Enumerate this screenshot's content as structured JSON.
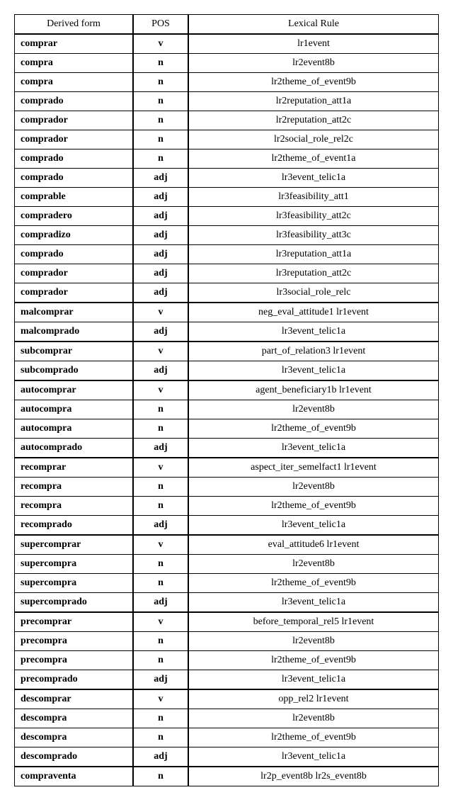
{
  "chart_data": {
    "type": "table",
    "headers": [
      "Derived form",
      "POS",
      "Lexical Rule"
    ],
    "rows": [
      {
        "form": "comprar",
        "pos": "v",
        "rule": "lr1event",
        "break": false
      },
      {
        "form": "compra",
        "pos": "n",
        "rule": "lr2event8b",
        "break": false
      },
      {
        "form": "compra",
        "pos": "n",
        "rule": "lr2theme_of_event9b",
        "break": false
      },
      {
        "form": "comprado",
        "pos": "n",
        "rule": "lr2reputation_att1a",
        "break": false
      },
      {
        "form": "comprador",
        "pos": "n",
        "rule": "lr2reputation_att2c",
        "break": false
      },
      {
        "form": "comprador",
        "pos": "n",
        "rule": "lr2social_role_rel2c",
        "break": false
      },
      {
        "form": "comprado",
        "pos": "n",
        "rule": "lr2theme_of_event1a",
        "break": false
      },
      {
        "form": "comprado",
        "pos": "adj",
        "rule": "lr3event_telic1a",
        "break": false
      },
      {
        "form": "comprable",
        "pos": "adj",
        "rule": "lr3feasibility_att1",
        "break": false
      },
      {
        "form": "compradero",
        "pos": "adj",
        "rule": "lr3feasibility_att2c",
        "break": false
      },
      {
        "form": "compradizo",
        "pos": "adj",
        "rule": "lr3feasibility_att3c",
        "break": false
      },
      {
        "form": "comprado",
        "pos": "adj",
        "rule": "lr3reputation_att1a",
        "break": false
      },
      {
        "form": "comprador",
        "pos": "adj",
        "rule": "lr3reputation_att2c",
        "break": false
      },
      {
        "form": "comprador",
        "pos": "adj",
        "rule": "lr3social_role_relc",
        "break": false
      },
      {
        "form": "malcomprar",
        "pos": "v",
        "rule": "neg_eval_attitude1 lr1event",
        "break": true
      },
      {
        "form": "malcomprado",
        "pos": "adj",
        "rule": "lr3event_telic1a",
        "break": false
      },
      {
        "form": "subcomprar",
        "pos": "v",
        "rule": "part_of_relation3 lr1event",
        "break": true
      },
      {
        "form": "subcomprado",
        "pos": "adj",
        "rule": "lr3event_telic1a",
        "break": false
      },
      {
        "form": "autocomprar",
        "pos": "v",
        "rule": "agent_beneficiary1b lr1event",
        "break": true
      },
      {
        "form": "autocompra",
        "pos": "n",
        "rule": "lr2event8b",
        "break": false
      },
      {
        "form": "autocompra",
        "pos": "n",
        "rule": "lr2theme_of_event9b",
        "break": false
      },
      {
        "form": "autocomprado",
        "pos": "adj",
        "rule": "lr3event_telic1a",
        "break": false
      },
      {
        "form": "recomprar",
        "pos": "v",
        "rule": "aspect_iter_semelfact1 lr1event",
        "break": true
      },
      {
        "form": "recompra",
        "pos": "n",
        "rule": "lr2event8b",
        "break": false
      },
      {
        "form": "recompra",
        "pos": "n",
        "rule": "lr2theme_of_event9b",
        "break": false
      },
      {
        "form": "recomprado",
        "pos": "adj",
        "rule": "lr3event_telic1a",
        "break": false
      },
      {
        "form": "supercomprar",
        "pos": "v",
        "rule": "eval_attitude6 lr1event",
        "break": true
      },
      {
        "form": "supercompra",
        "pos": "n",
        "rule": "lr2event8b",
        "break": false
      },
      {
        "form": "supercompra",
        "pos": "n",
        "rule": "lr2theme_of_event9b",
        "break": false
      },
      {
        "form": "supercomprado",
        "pos": "adj",
        "rule": "lr3event_telic1a",
        "break": false
      },
      {
        "form": "precomprar",
        "pos": "v",
        "rule": "before_temporal_rel5 lr1event",
        "break": true
      },
      {
        "form": "precompra",
        "pos": "n",
        "rule": "lr2event8b",
        "break": false
      },
      {
        "form": "precompra",
        "pos": "n",
        "rule": "lr2theme_of_event9b",
        "break": false
      },
      {
        "form": "precomprado",
        "pos": "adj",
        "rule": "lr3event_telic1a",
        "break": false
      },
      {
        "form": "descomprar",
        "pos": "v",
        "rule": "opp_rel2 lr1event",
        "break": true
      },
      {
        "form": "descompra",
        "pos": "n",
        "rule": "lr2event8b",
        "break": false
      },
      {
        "form": "descompra",
        "pos": "n",
        "rule": "lr2theme_of_event9b",
        "break": false
      },
      {
        "form": "descomprado",
        "pos": "adj",
        "rule": "lr3event_telic1a",
        "break": false
      },
      {
        "form": "compraventa",
        "pos": "n",
        "rule": "lr2p_event8b lr2s_event8b",
        "break": true
      }
    ]
  }
}
